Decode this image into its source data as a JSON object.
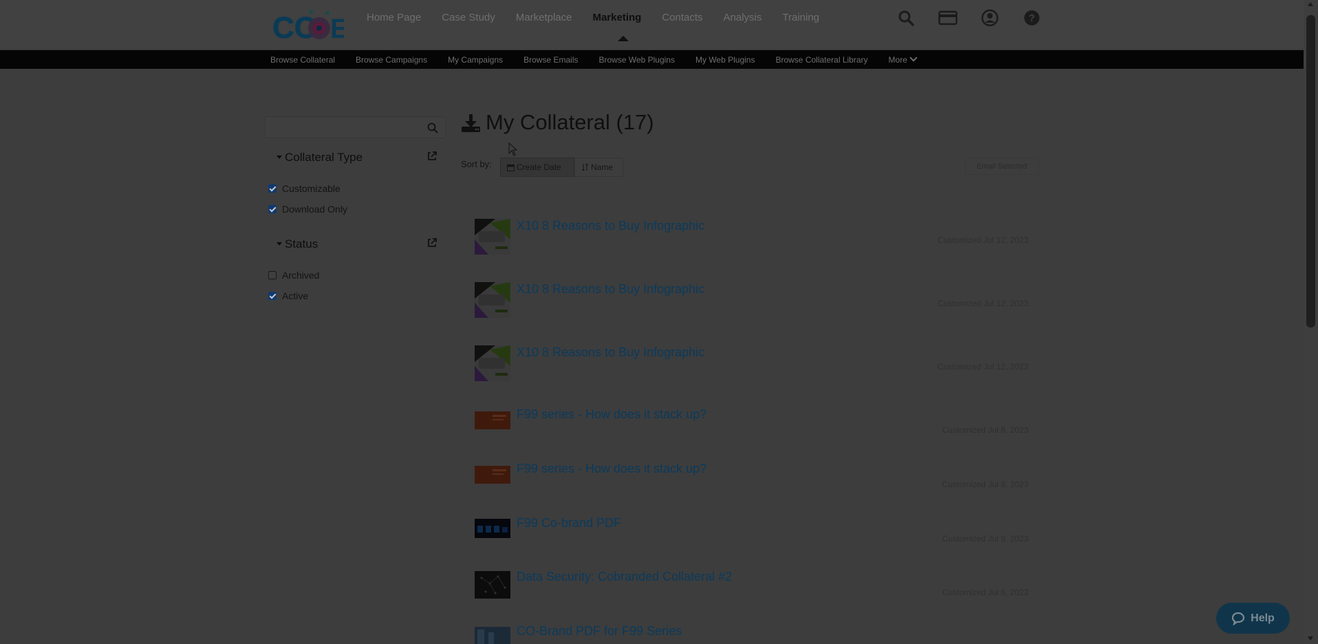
{
  "header": {
    "nav": [
      "Home Page",
      "Case Study",
      "Marketplace",
      "Marketing",
      "Contacts",
      "Analysis",
      "Training"
    ],
    "active_nav": "Marketing",
    "icons": [
      "search-icon",
      "credit-card-icon",
      "user-icon",
      "help-icon"
    ]
  },
  "subnav": {
    "items": [
      "Browse Collateral",
      "Browse Campaigns",
      "My Campaigns",
      "Browse Emails",
      "Browse Web Plugins",
      "My Web Plugins",
      "Browse Collateral Library"
    ],
    "more_label": "More"
  },
  "sidebar": {
    "search": {
      "value": "",
      "placeholder": ""
    },
    "collateral_type": {
      "title": "Collateral Type",
      "options": [
        {
          "label": "Customizable",
          "checked": true
        },
        {
          "label": "Download Only",
          "checked": true
        }
      ]
    },
    "status": {
      "title": "Status",
      "options": [
        {
          "label": "Archived",
          "checked": false
        },
        {
          "label": "Active",
          "checked": true
        }
      ]
    }
  },
  "main": {
    "title": "My Collateral (17)",
    "sort_label": "Sort by:",
    "sort_options": [
      "Create Date",
      "Name"
    ],
    "active_sort": "Create Date",
    "email_selected_label": "Email Selected",
    "items": [
      {
        "title": "X10 8 Reasons to Buy Infographic",
        "meta": "Customized Jul 12, 2023",
        "thumb": "infographic"
      },
      {
        "title": "X10 8 Reasons to Buy Infographic",
        "meta": "Customized Jul 12, 2023",
        "thumb": "infographic"
      },
      {
        "title": "X10 8 Reasons to Buy Infographic",
        "meta": "Customized Jul 12, 2023",
        "thumb": "infographic"
      },
      {
        "title": "F99 series - How does it stack up?",
        "meta": "Customized Jul 8, 2023",
        "thumb": "orange"
      },
      {
        "title": "F99 series - How does it stack up?",
        "meta": "Customized Jul 8, 2023",
        "thumb": "orange"
      },
      {
        "title": "F99 Co-brand PDF",
        "meta": "Customized Jul 8, 2023",
        "thumb": "dark-blue"
      },
      {
        "title": "Data Security: Cobranded Collateral #2",
        "meta": "Customized Jul 6, 2023",
        "thumb": "dark-dots"
      },
      {
        "title": "CO-Brand PDF for F99 Series",
        "meta": "",
        "thumb": "blue"
      }
    ]
  },
  "help": {
    "label": "Help"
  },
  "colors": {
    "overlay_bg": "#3d3d3d",
    "link": "#0a3a5c",
    "subnav_bg": "#050505",
    "help_bg": "#10354a"
  }
}
